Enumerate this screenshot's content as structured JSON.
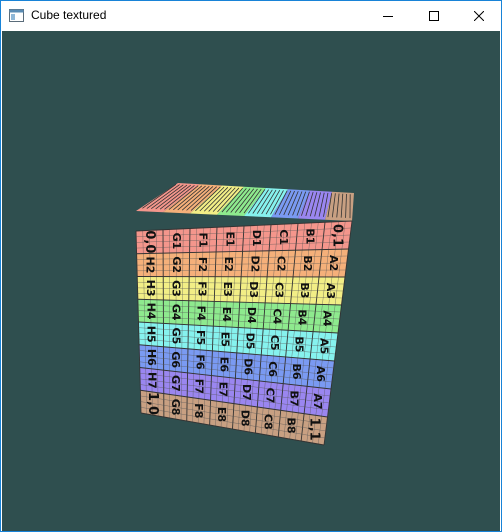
{
  "window": {
    "title": "Cube textured",
    "icon": "app-window-icon",
    "buttons": {
      "minimize": "minimize-icon",
      "maximize": "maximize-icon",
      "close": "close-icon"
    }
  },
  "viewport": {
    "background_color": "#2f4f4f"
  },
  "cube": {
    "front_face": {
      "band_colors": [
        "#f4968c",
        "#f5b07a",
        "#f2ee86",
        "#8eea8e",
        "#86f2ee",
        "#7a9af2",
        "#9a86f0",
        "#c8a082"
      ],
      "rows": [
        [
          "0,0",
          "G1",
          "F1",
          "E1",
          "D1",
          "C1",
          "B1",
          "0,1"
        ],
        [
          "H2",
          "G2",
          "F2",
          "E2",
          "D2",
          "C2",
          "B2",
          "A2"
        ],
        [
          "H3",
          "G3",
          "F3",
          "E3",
          "D3",
          "C3",
          "B3",
          "A3"
        ],
        [
          "H4",
          "G4",
          "F4",
          "E4",
          "D4",
          "C4",
          "B4",
          "A4"
        ],
        [
          "H5",
          "G5",
          "F5",
          "E5",
          "D5",
          "C5",
          "B5",
          "A5"
        ],
        [
          "H6",
          "G6",
          "F6",
          "E6",
          "D6",
          "C6",
          "B6",
          "A6"
        ],
        [
          "H7",
          "G7",
          "F7",
          "E7",
          "D7",
          "C7",
          "B7",
          "A7"
        ],
        [
          "1,0",
          "G8",
          "F8",
          "E8",
          "D8",
          "C8",
          "B8",
          "1,1"
        ]
      ]
    },
    "top_face": {
      "band_colors": [
        "#f4968c",
        "#f5b07a",
        "#f2ee86",
        "#8eea8e",
        "#86f2ee",
        "#7a9af2",
        "#9a86f0",
        "#c8a082"
      ]
    }
  }
}
